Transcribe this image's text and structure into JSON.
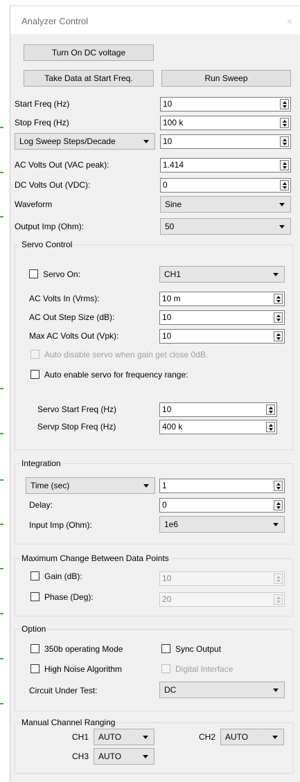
{
  "window": {
    "title": "Analyzer Control",
    "close_icon": "close-icon"
  },
  "buttons": {
    "dc_voltage": "Turn On DC voltage",
    "take_data": "Take Data at Start Freq.",
    "run_sweep": "Run Sweep"
  },
  "fields": {
    "start_freq": {
      "label": "Start Freq (Hz)",
      "value": "10"
    },
    "stop_freq": {
      "label": "Stop Freq (Hz)",
      "value": "100 k"
    },
    "sweep_steps": {
      "mode": "Log Sweep Steps/Decade",
      "value": "10"
    },
    "ac_volts_out": {
      "label": "AC Volts Out (VAC peak):",
      "value": "1.414"
    },
    "dc_volts_out": {
      "label": "DC Volts Out (VDC):",
      "value": "0"
    },
    "waveform": {
      "label": "Waveform",
      "value": "Sine"
    },
    "output_imp": {
      "label": "Output Imp (Ohm):",
      "value": "50"
    }
  },
  "servo": {
    "group_title": "Servo Control",
    "servo_on": {
      "label": "Servo On:",
      "checked": false,
      "channel": "CH1"
    },
    "ac_volts_in": {
      "label": "AC Volts In (Vrms):",
      "value": "10 m"
    },
    "step_size": {
      "label": "AC Out Step Size (dB):",
      "value": "10"
    },
    "max_ac_volts": {
      "label": "Max AC Volts Out (Vpk):",
      "value": "10"
    },
    "auto_disable": {
      "label": "Auto disable servo when gain get close 0dB.",
      "checked": false,
      "enabled": false
    },
    "auto_enable": {
      "label": "Auto enable servo for frequency range:",
      "checked": false
    },
    "start_freq": {
      "label": "Servo Start Freq (Hz)",
      "value": "10"
    },
    "stop_freq": {
      "label": "Servp Stop Freq (Hz)",
      "value": "400 k"
    }
  },
  "integration": {
    "group_title": "Integration",
    "mode": "Time (sec)",
    "mode_value": "1",
    "delay": {
      "label": "Delay:",
      "value": "0"
    },
    "input_imp": {
      "label": "Input Imp (Ohm):",
      "value": "1e6"
    }
  },
  "max_change": {
    "group_title": "Maximum Change Between Data Points",
    "gain": {
      "label": "Gain (dB):",
      "value": "10",
      "checked": false
    },
    "phase": {
      "label": "Phase (Deg):",
      "value": "20",
      "checked": false
    }
  },
  "option": {
    "group_title": "Option",
    "mode_350b": {
      "label": "350b operating Mode",
      "checked": false
    },
    "sync_output": {
      "label": "Sync Output",
      "checked": false
    },
    "high_noise": {
      "label": "High Noise Algorithm",
      "checked": false
    },
    "digital_interface": {
      "label": "Digital Interface",
      "checked": false,
      "enabled": false
    },
    "circuit": {
      "label": "Circuit Under Test:",
      "value": "DC"
    }
  },
  "ranging": {
    "group_title": "Manual Channel Ranging",
    "ch1": {
      "label": "CH1",
      "value": "AUTO"
    },
    "ch2": {
      "label": "CH2",
      "value": "AUTO"
    },
    "ch3": {
      "label": "CH3",
      "value": "AUTO"
    }
  }
}
